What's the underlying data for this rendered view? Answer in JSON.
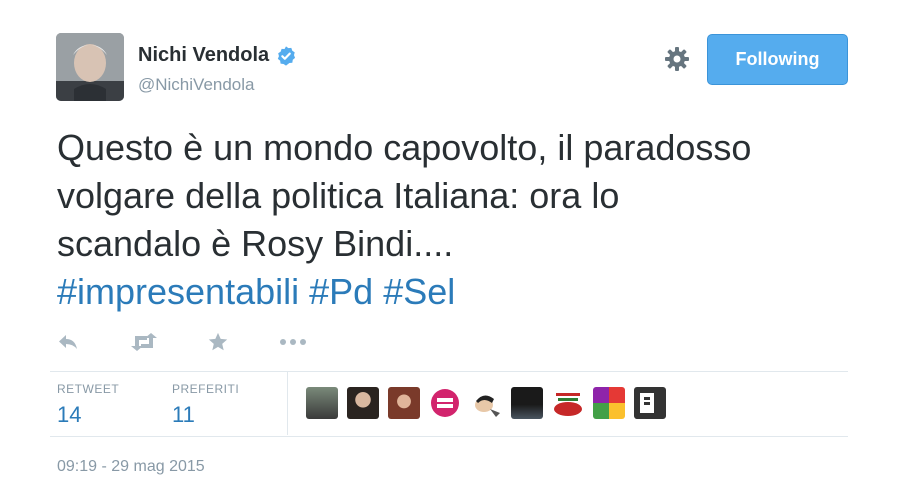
{
  "user": {
    "name": "Nichi Vendola",
    "handle": "@NichiVendola",
    "verified": true,
    "avatar_icon": "user-avatar-photo"
  },
  "header": {
    "settings_icon": "gear-icon",
    "follow_label": "Following"
  },
  "tweet": {
    "lines": [
      "Questo è un mondo capovolto, il paradosso",
      "volgare della politica Italiana: ora lo",
      "scandalo è Rosy Bindi...."
    ],
    "hashtags": [
      "#impresentabili",
      "#Pd",
      "#Sel"
    ]
  },
  "actions": {
    "icons": [
      "reply-icon",
      "retweet-icon",
      "favorite-star-icon",
      "more-icon"
    ]
  },
  "stats": {
    "retweet_label": "RETWEET",
    "retweet_count": "14",
    "favorites_label": "PREFERITI",
    "favorites_count": "11"
  },
  "timestamp": "09:19 - 29 mag 2015",
  "colors": {
    "accent": "#55acee",
    "link": "#2b7bb9",
    "muted": "#8899a6",
    "text": "#292f33",
    "divider": "#e1e8ed"
  }
}
